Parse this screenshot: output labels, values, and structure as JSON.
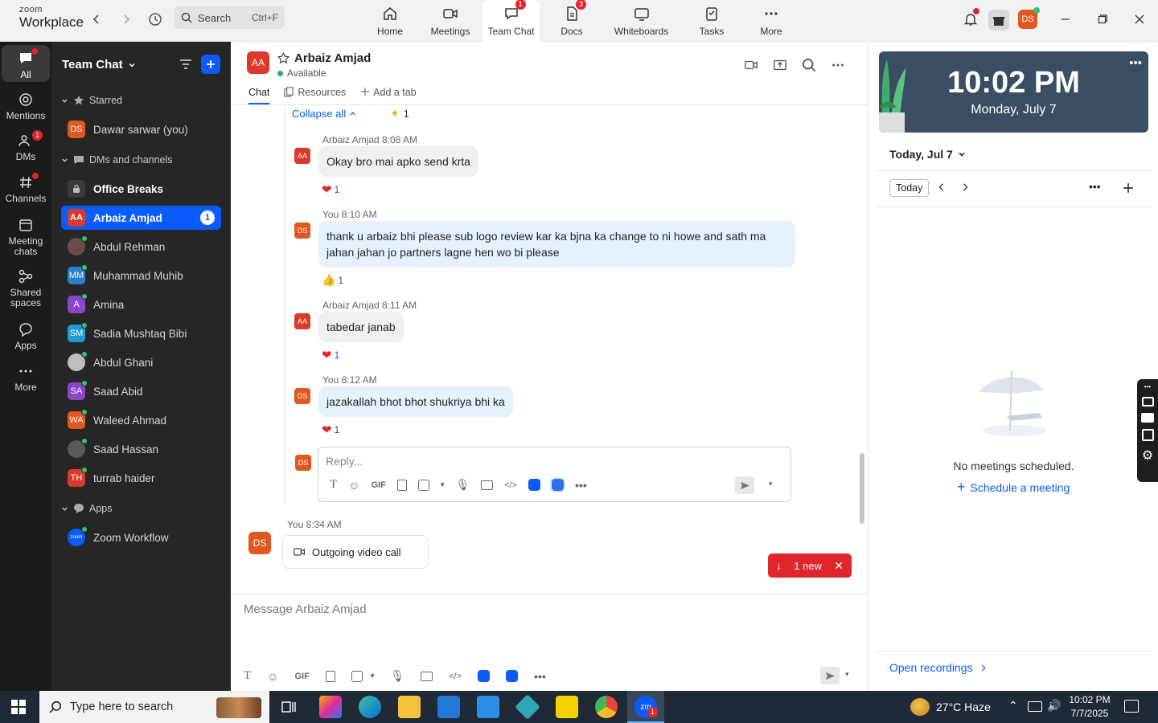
{
  "app": {
    "logo_top": "zoom",
    "logo_bottom": "Workplace"
  },
  "search": {
    "label": "Search",
    "shortcut": "Ctrl+F"
  },
  "top_tabs": [
    {
      "label": "Home",
      "badge": ""
    },
    {
      "label": "Meetings",
      "badge": ""
    },
    {
      "label": "Team Chat",
      "badge": "1"
    },
    {
      "label": "Docs",
      "badge": "3"
    },
    {
      "label": "Whiteboards",
      "badge": ""
    },
    {
      "label": "Tasks",
      "badge": ""
    },
    {
      "label": "More",
      "badge": ""
    }
  ],
  "user_initials": "DS",
  "rail": [
    {
      "label": "All"
    },
    {
      "label": "Mentions"
    },
    {
      "label": "DMs",
      "badge": "1"
    },
    {
      "label": "Channels"
    },
    {
      "label": "Meeting chats"
    },
    {
      "label": "Shared spaces"
    },
    {
      "label": "Apps"
    },
    {
      "label": "More"
    }
  ],
  "sidebar": {
    "title": "Team Chat",
    "sections": {
      "starred": "Starred",
      "dms": "DMs and channels",
      "apps": "Apps"
    },
    "starred_item": {
      "initials": "DS",
      "name": "Dawar sarwar (you)"
    },
    "items": [
      {
        "initials": "",
        "name": "Office Breaks"
      },
      {
        "initials": "AA",
        "name": "Arbaiz Amjad",
        "badge": "1"
      },
      {
        "initials": "",
        "name": "Abdul Rehman"
      },
      {
        "initials": "MM",
        "name": "Muhammad Muhib"
      },
      {
        "initials": "A",
        "name": "Amina"
      },
      {
        "initials": "SM",
        "name": "Sadia Mushtaq Bibi"
      },
      {
        "initials": "",
        "name": "Abdul Ghani"
      },
      {
        "initials": "SA",
        "name": "Saad Abid"
      },
      {
        "initials": "WA",
        "name": "Waleed Ahmad"
      },
      {
        "initials": "",
        "name": "Saad Hassan"
      },
      {
        "initials": "TH",
        "name": "turrab haider"
      }
    ],
    "app_item": {
      "initials": "zoom",
      "name": "Zoom Workflow"
    }
  },
  "chat": {
    "contact_initials": "AA",
    "contact_name": "Arbaiz Amjad",
    "status": "Available",
    "tabs": [
      "Chat",
      "Resources",
      "Add a tab"
    ],
    "collapse": "Collapse all",
    "ai_count": "1",
    "messages": [
      {
        "initials": "AA",
        "meta": "Arbaiz Amjad  8:08 AM",
        "text": "Okay bro mai apko send krta",
        "reaction": "1"
      },
      {
        "initials": "DS",
        "meta": "You  8:10 AM",
        "text": "thank u arbaiz bhi please sub logo review kar ka bjna ka change to ni howe and sath ma jahan jahan jo partners lagne hen wo bi please",
        "reaction": "1"
      },
      {
        "initials": "AA",
        "meta": "Arbaiz Amjad  8:11 AM",
        "text": "tabedar janab",
        "reaction": "1"
      },
      {
        "initials": "DS",
        "meta": "You  8:12 AM",
        "text": "jazakallah bhot bhot shukriya bhi ka",
        "reaction": "1"
      }
    ],
    "reply_placeholder": "Reply...",
    "reply_initials": "DS",
    "call": {
      "initials": "DS",
      "meta": "You  8:34 AM",
      "label": "Outgoing video call"
    },
    "new_pill": "1 new",
    "compose_placeholder": "Message Arbaiz Amjad",
    "gif": "GIF"
  },
  "calendar": {
    "time": "10:02 PM",
    "date": "Monday, July 7",
    "day_label": "Today, Jul 7",
    "today_button": "Today",
    "empty_text": "No meetings scheduled.",
    "schedule": "Schedule a meeting",
    "recordings": "Open recordings"
  },
  "taskbar": {
    "search_placeholder": "Type here to search",
    "weather": "27°C  Haze",
    "time": "10:02 PM",
    "date": "7/7/2025",
    "zoom_badge": "1"
  }
}
